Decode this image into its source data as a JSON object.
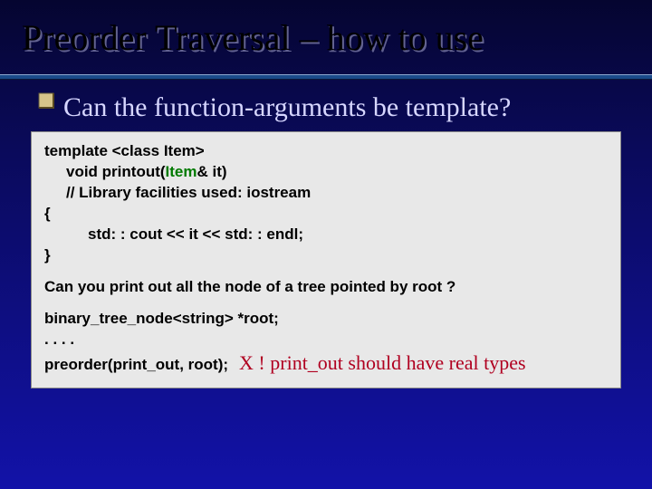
{
  "slide": {
    "title": "Preorder Traversal – how to use",
    "bullet": "Can the function-arguments be template?",
    "code": {
      "l1a": "template <class Item>",
      "l2a_pre": "void printout(",
      "l2a_item": "Item",
      "l2a_post": "& it)",
      "l2b": "// Library facilities used: iostream",
      "l1b": "{",
      "l3a": "std: : cout <<  it << std: : endl;",
      "l1c": "}",
      "q": "Can you print out all the node of a tree pointed by root ?",
      "l1d": "binary_tree_node<string> *root;",
      "l1e": ". . . .",
      "l1f": "preorder(print_out, root);",
      "warn": "X ! print_out should have real types"
    }
  }
}
